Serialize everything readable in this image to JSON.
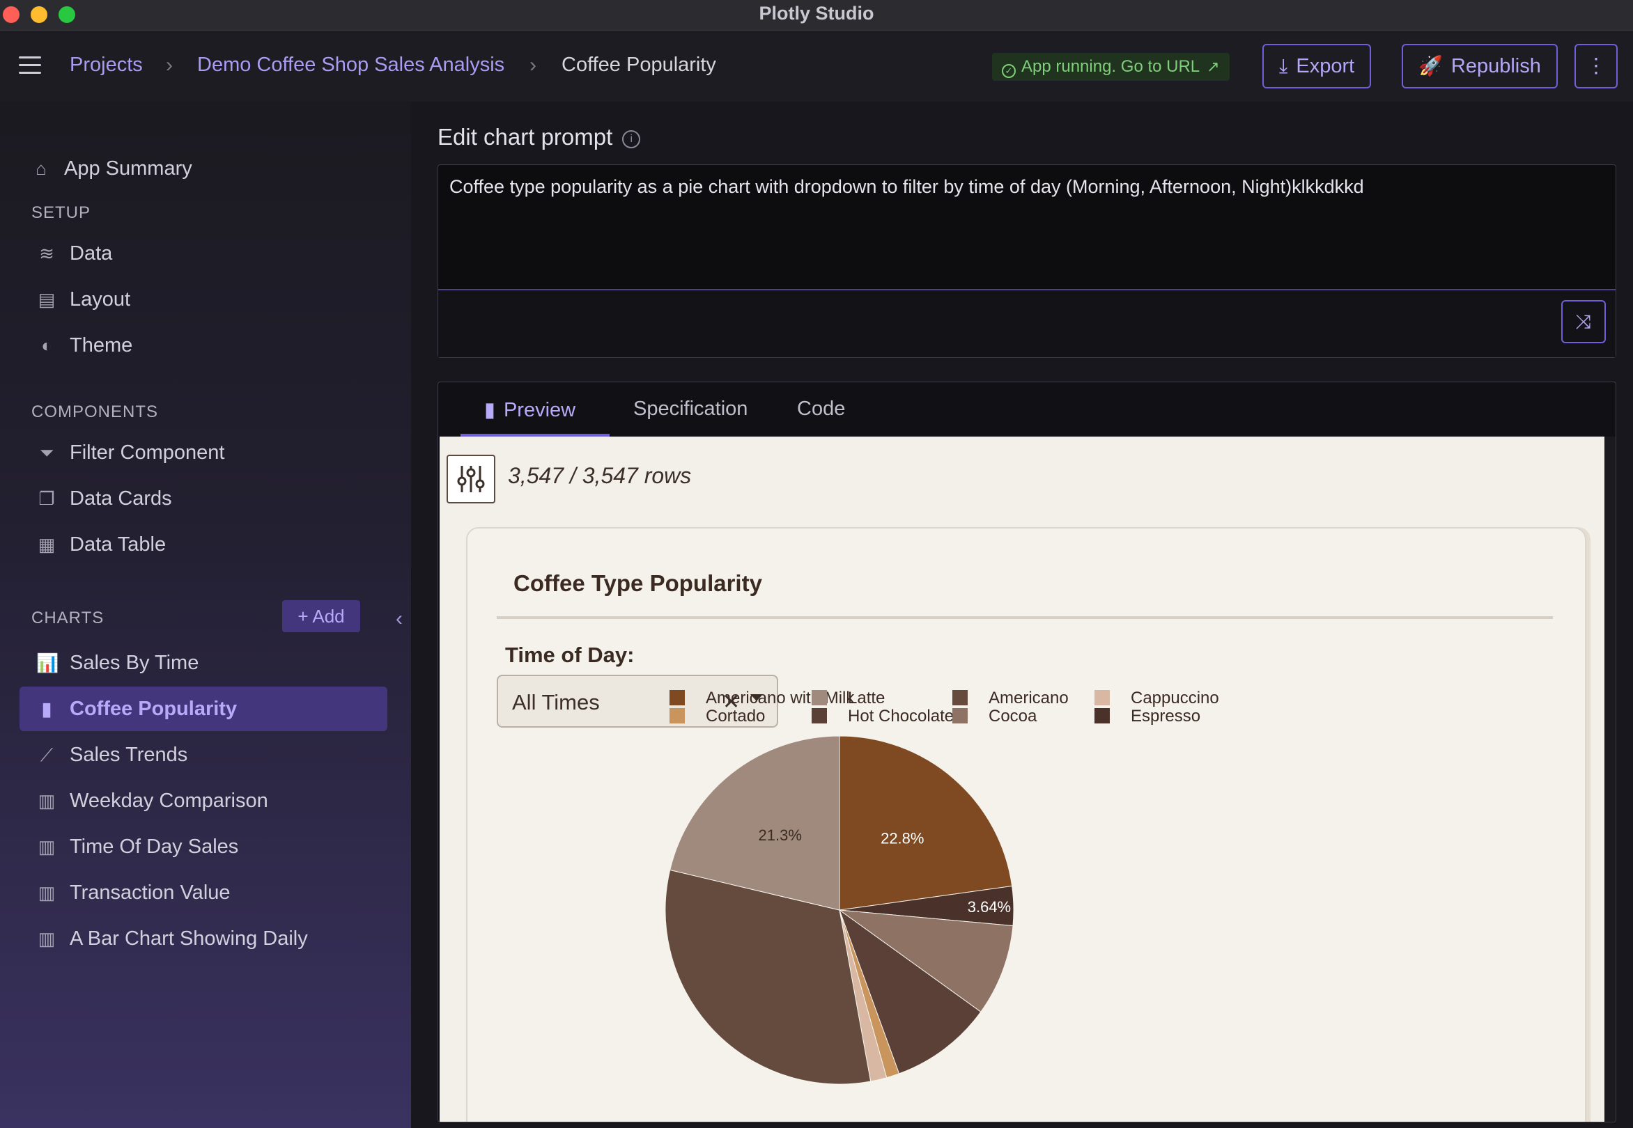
{
  "window": {
    "title": "Plotly Studio"
  },
  "header": {
    "breadcrumbs": [
      "Projects",
      "Demo Coffee Shop Sales Analysis",
      "Coffee Popularity"
    ],
    "status": "App running. Go to URL",
    "export_label": "Export",
    "republish_label": "Republish",
    "more_label": "⋮"
  },
  "sidebar": {
    "summary": "App Summary",
    "setup_heading": "SETUP",
    "setup_items": [
      "Data",
      "Layout",
      "Theme"
    ],
    "components_heading": "COMPONENTS",
    "component_items": [
      "Filter Component",
      "Data Cards",
      "Data Table"
    ],
    "charts_heading": "CHARTS",
    "add_label": "+ Add",
    "chart_items": [
      "Sales By Time",
      "Coffee Popularity",
      "Sales Trends",
      "Weekday Comparison",
      "Time Of Day Sales",
      "Transaction Value",
      "A Bar Chart Showing Daily"
    ],
    "active_chart": "Coffee Popularity"
  },
  "editor": {
    "title": "Edit chart prompt",
    "prompt": "Coffee type popularity as a pie chart with dropdown to filter by time of day (Morning, Afternoon, Night)klkkdkkd"
  },
  "tabs": [
    "Preview",
    "Specification",
    "Code"
  ],
  "active_tab": "Preview",
  "preview": {
    "rows": "3,547 / 3,547 rows",
    "card_title": "Coffee Type Popularity",
    "filter_label": "Time of Day:",
    "filter_value": "All Times"
  },
  "chart_data": {
    "type": "pie",
    "title": "Coffee Type Popularity",
    "legend": [
      "Americano with Milk",
      "Latte",
      "Americano",
      "Cappuccino",
      "Cortado",
      "Hot Chocolate",
      "Cocoa",
      "Espresso"
    ],
    "colors": [
      "#7f4a22",
      "#a08a7d",
      "#654a3e",
      "#d8b8a3",
      "#c9955c",
      "#5b4038",
      "#8e7264",
      "#4a3129"
    ],
    "visible_labels": [
      {
        "category": "Americano with Milk",
        "percent": 22.8
      },
      {
        "category": "Latte",
        "percent": 21.3
      },
      {
        "category": "Espresso",
        "percent": 3.64
      }
    ],
    "legend_placement": "top"
  }
}
